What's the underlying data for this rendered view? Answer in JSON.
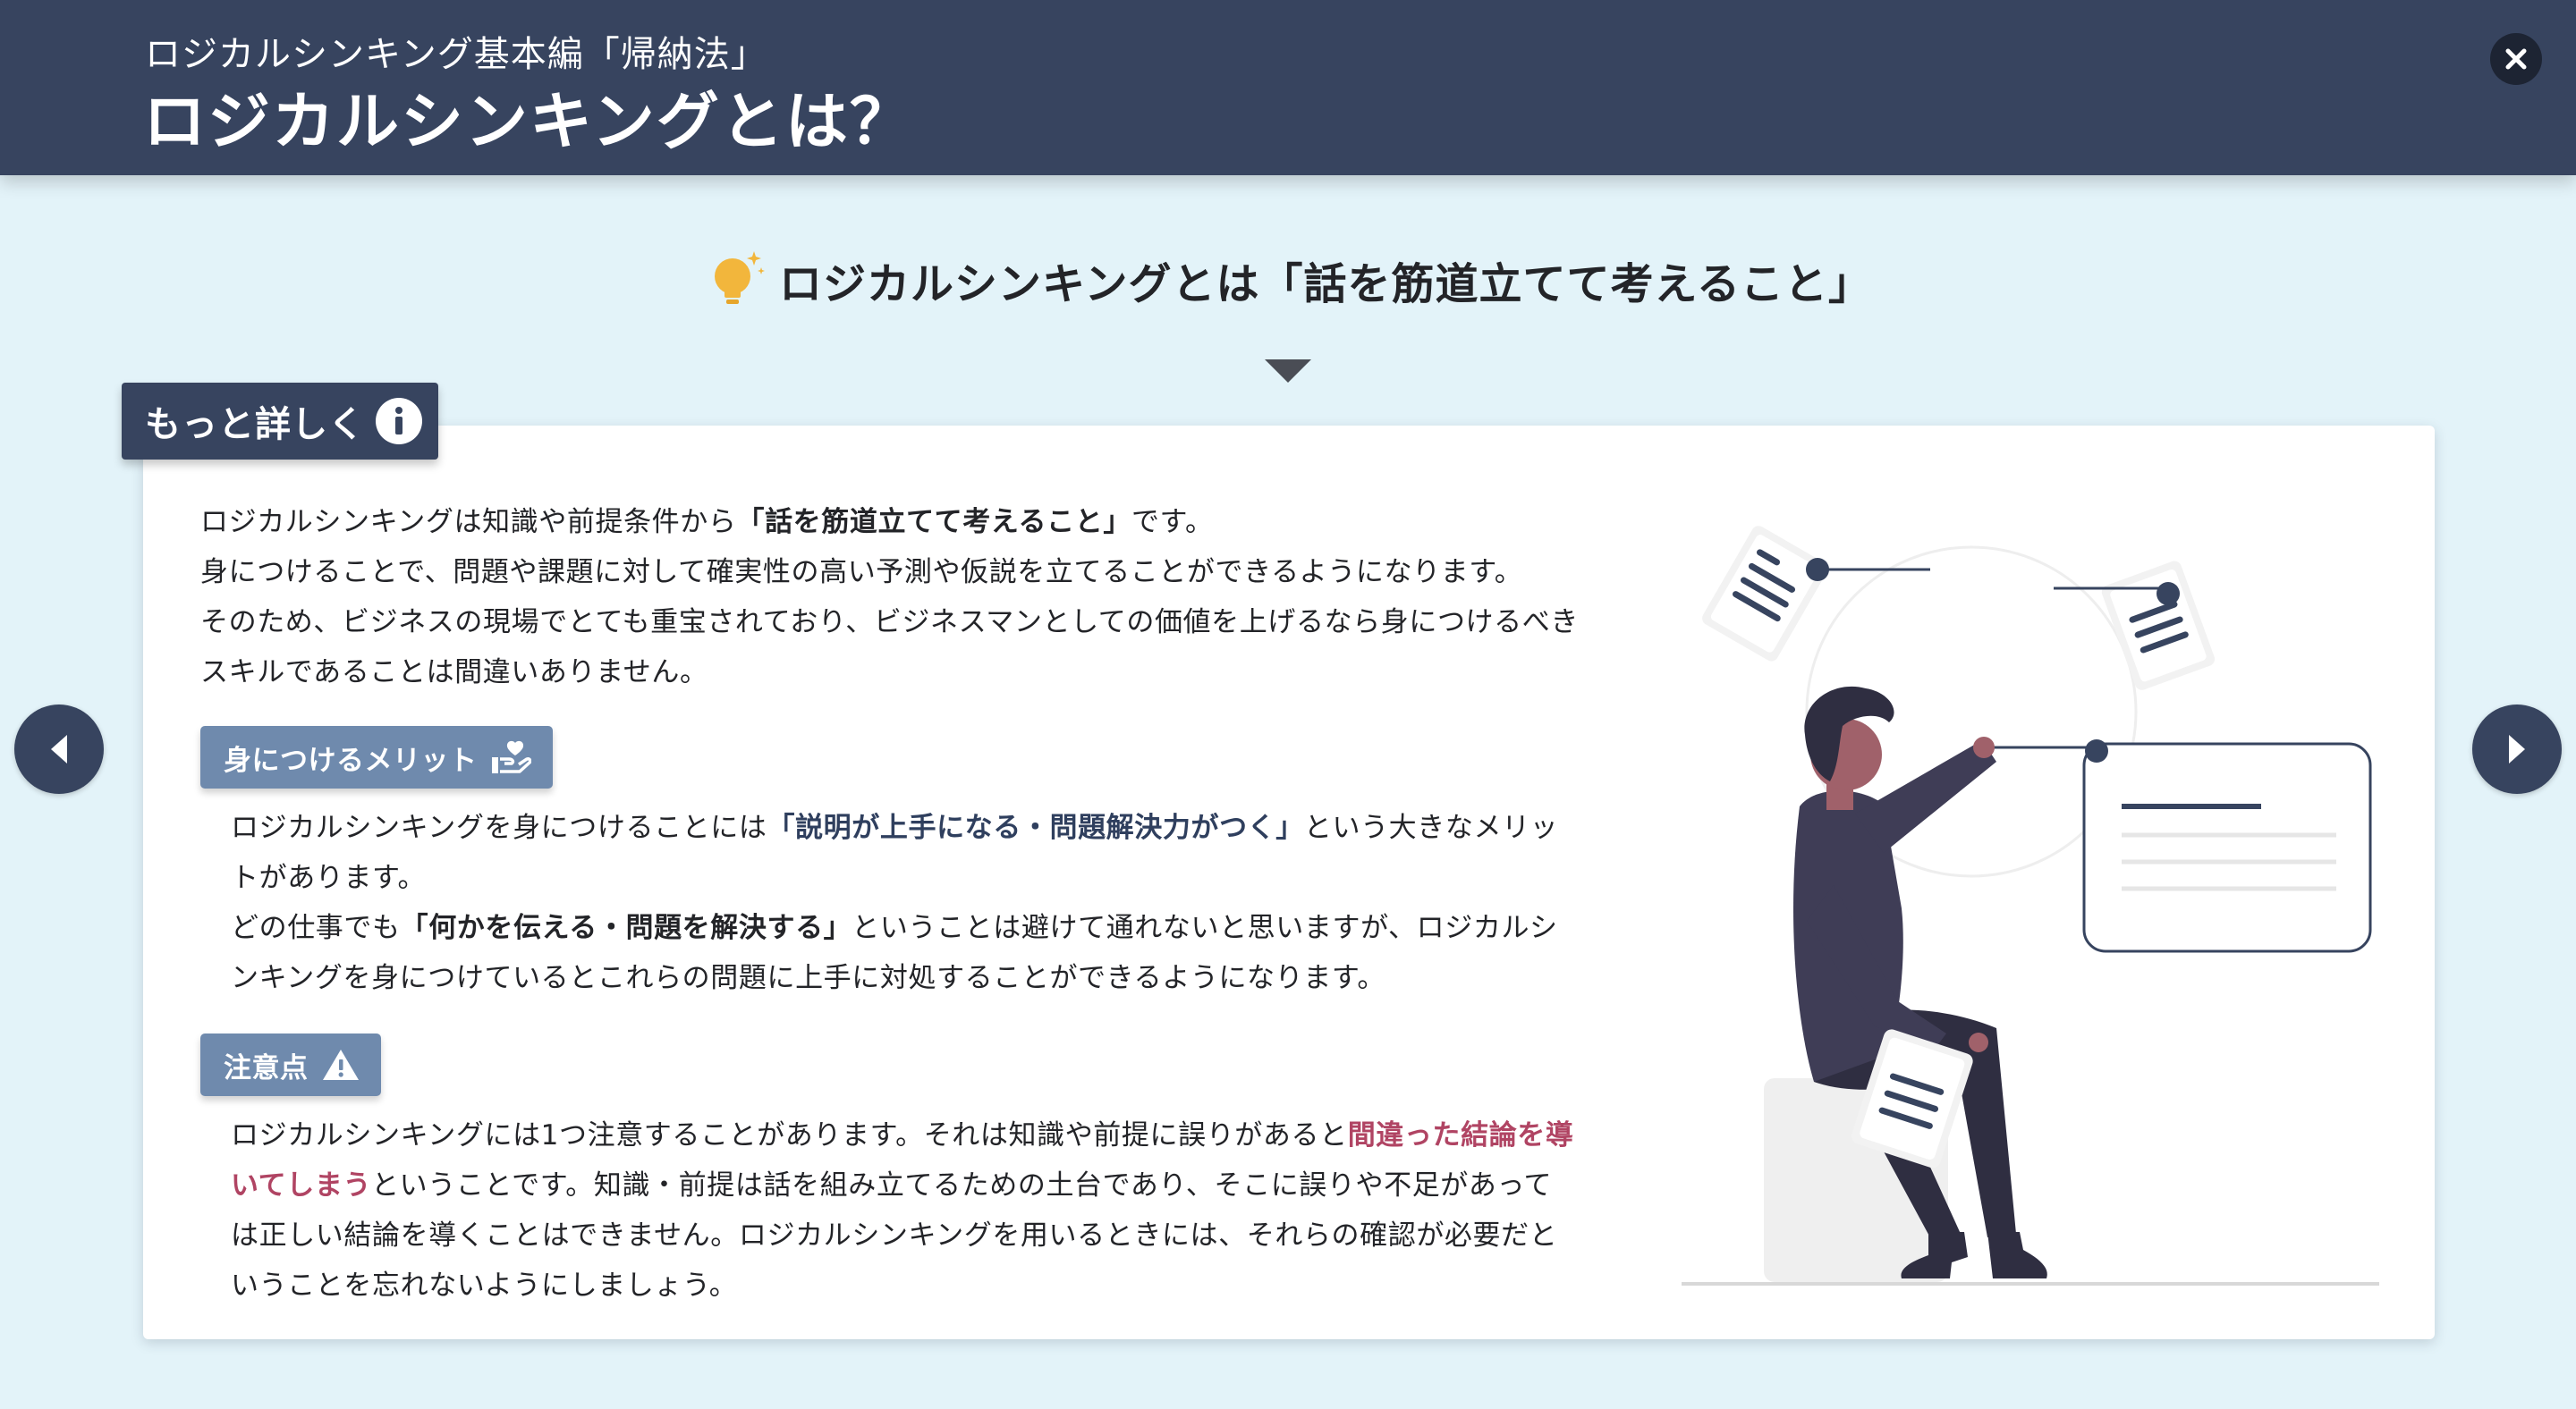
{
  "header": {
    "subtitle": "ロジカルシンキング基本編「帰納法」",
    "title": "ロジカルシンキングとは？",
    "close_icon": "close-icon"
  },
  "lead": {
    "icon": "lightbulb-icon",
    "text": "ロジカルシンキングとは「話を筋道立てて考えること」"
  },
  "more_tab": {
    "label": "もっと詳しく",
    "icon": "info-icon"
  },
  "intro": {
    "line1_a": "ロジカルシンキングは知識や前提条件から",
    "line1_em": "「話を筋道立てて考えること」",
    "line1_b": "です。",
    "line2": "身につけることで、問題や課題に対して確実性の高い予測や仮説を立てることができるようになります。",
    "line3": "そのため、ビジネスの現場でとても重宝されており、ビジネスマンとしての価値を上げるなら身につけるべき",
    "line4": "スキルであることは間違いありません。"
  },
  "merit": {
    "badge_label": "身につけるメリット",
    "badge_icon": "hand-heart-icon",
    "t1": "ロジカルシンキングを身につけることには",
    "em1": "「説明が上手になる・問題解決力がつく」",
    "t2": "という大きなメリッ",
    "t3": "トがあります。",
    "t4": "どの仕事でも",
    "em2": "「何かを伝える・問題を解決する」",
    "t5": "ということは避けて通れないと思いますが、ロジカルシ",
    "t6": "ンキングを身につけているとこれらの問題に上手に対処することができるようになります。"
  },
  "caution": {
    "badge_label": "注意点",
    "badge_icon": "warning-icon",
    "t1": "ロジカルシンキングには1つ注意することがあります。それは知識や前提に誤りがあると",
    "em1": "間違った結論を導",
    "em2": "いてしまう",
    "t2": "ということです。知識・前提は話を組み立てるための土台であり、そこに誤りや不足があって",
    "t3": "は正しい結論を導くことはできません。ロジカルシンキングを用いるときには、それらの確認が必要だと",
    "t4": "いうことを忘れないようにしましょう。"
  },
  "nav": {
    "prev_icon": "chevron-left-icon",
    "next_icon": "chevron-right-icon"
  },
  "colors": {
    "header_bg": "#37445f",
    "page_bg": "#e3f3f9",
    "badge_bg": "#6f8aad",
    "emphasis_blue": "#2f3f5e",
    "emphasis_red": "#b04463",
    "bulb": "#f2b63c"
  }
}
